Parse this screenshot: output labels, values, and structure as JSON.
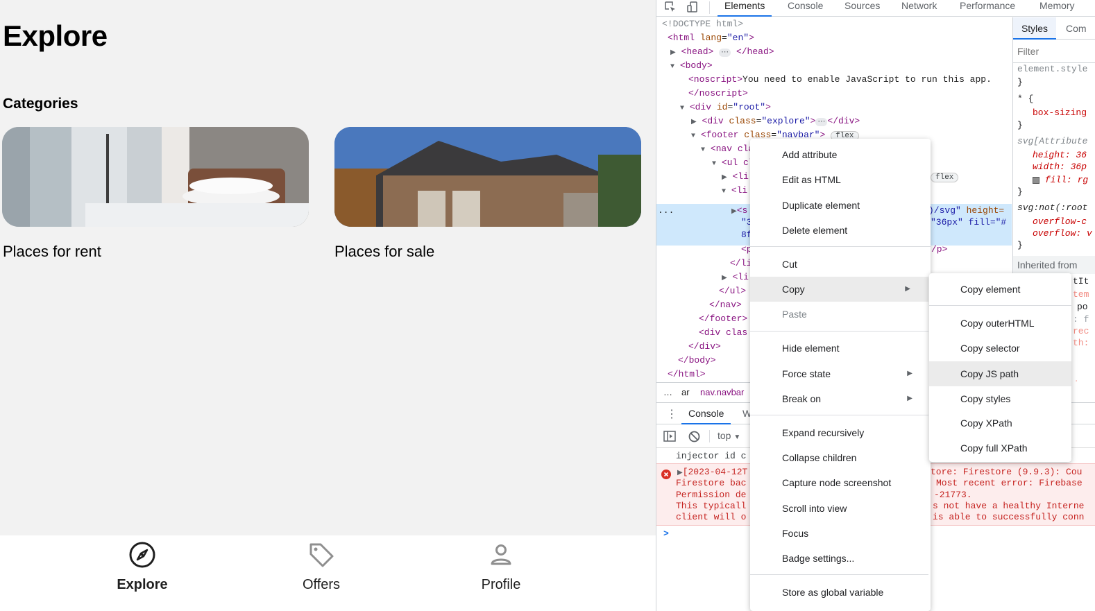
{
  "app": {
    "title": "Explore",
    "section_title": "Categories",
    "cards": [
      {
        "label": "Places for rent"
      },
      {
        "label": "Places for sale"
      }
    ],
    "navbar": [
      {
        "label": "Explore",
        "icon": "compass-icon",
        "active": true
      },
      {
        "label": "Offers",
        "icon": "tag-icon",
        "active": false
      },
      {
        "label": "Profile",
        "icon": "person-icon",
        "active": false
      }
    ]
  },
  "devtools": {
    "tabs": [
      "Elements",
      "Console",
      "Sources",
      "Network",
      "Performance",
      "Memory"
    ],
    "active_tab": "Elements",
    "dom": {
      "doctype": "<!DOCTYPE html>",
      "html_open": "<html",
      "html_attr": "lang",
      "html_val": "\"en\"",
      "gt": ">",
      "head": "<head>",
      "head_close": "</head>",
      "body_open": "<body>",
      "noscript_open": "<noscript>",
      "noscript_text": "You need to enable JavaScript to run this app.",
      "noscript_close": "</noscript>",
      "div": "<div",
      "id_attr": "id",
      "root_val": "\"root\"",
      "class_attr": "class",
      "explore_val": "\"explore\"",
      "div_close": "</div>",
      "footer_open": "<footer",
      "navbar_val": "\"navbar\"",
      "flex_badge": "flex",
      "nav_partial": "<nav cla",
      "ul_partial": "<ul cl",
      "li_partial": "<li",
      "svg_partial": "<s",
      "sel_right_1a": ")/svg\"",
      "sel_right_1b": "height=",
      "sel_right_2": "\"36px\" fill=\"#",
      "sel_left_2": "\"3",
      "sel_left_3": "8f",
      "p_partial": "<p",
      "p_close_right": "/p>",
      "li_close": "</li",
      "ul_close": "</ul>",
      "nav_close": "</nav>",
      "footer_close": "</footer>",
      "div_clas": "<div clas",
      "body_close": "</body>",
      "html_close": "</html>",
      "ellipsis": "..."
    },
    "breadcrumb": {
      "left": "ar",
      "item": "nav.navbar"
    },
    "drawer_tabs": [
      "Console",
      "W"
    ],
    "console_context": "top",
    "console_lines": {
      "injector": "injector id c",
      "err_date": "[2023-04-12T",
      "err_line2": "Firestore bac",
      "err_line3": "Permission de",
      "err_line4": "This typicall",
      "err_line5": "client will o",
      "err_right1": "tore: Firestore (9.9.3): Cou",
      "err_right2": "Most recent error: Firebase",
      "err_right3": "-21773.",
      "err_right4": "s not have a healthy Interne",
      "err_right5": "is able to successfully conn",
      "prompt": ">"
    },
    "styles_pane": {
      "tabs": [
        "Styles",
        "Com"
      ],
      "filter_placeholder": "Filter",
      "lines": [
        "element.style",
        "}",
        "* {",
        "box-sizing",
        "}",
        "svg[Attribute",
        "height: 36",
        "width: 36p",
        "fill: rg",
        "}",
        "svg:not(:root",
        "overflow-c",
        "overflow: v",
        "}"
      ],
      "inherited": "Inherited from",
      "frag1": "tIt",
      "frag2": "tem",
      "frag3": "po",
      "frag4": ": f",
      "frag5": "rec",
      "frag6": "th:",
      "frag7": "ign"
    }
  },
  "context_menu": {
    "items": [
      {
        "label": "Add attribute"
      },
      {
        "label": "Edit as HTML"
      },
      {
        "label": "Duplicate element"
      },
      {
        "label": "Delete element"
      },
      {
        "label": "Cut"
      },
      {
        "label": "Copy",
        "has_submenu": true,
        "highlighted": true
      },
      {
        "label": "Paste",
        "disabled": true
      },
      {
        "label": "Hide element"
      },
      {
        "label": "Force state",
        "has_submenu": true
      },
      {
        "label": "Break on",
        "has_submenu": true
      },
      {
        "label": "Expand recursively"
      },
      {
        "label": "Collapse children"
      },
      {
        "label": "Capture node screenshot"
      },
      {
        "label": "Scroll into view"
      },
      {
        "label": "Focus"
      },
      {
        "label": "Badge settings..."
      },
      {
        "label": "Store as global variable"
      }
    ]
  },
  "copy_submenu": {
    "items": [
      {
        "label": "Copy element"
      },
      {
        "label": "Copy outerHTML"
      },
      {
        "label": "Copy selector"
      },
      {
        "label": "Copy JS path",
        "highlighted": true
      },
      {
        "label": "Copy styles"
      },
      {
        "label": "Copy XPath"
      },
      {
        "label": "Copy full XPath"
      }
    ]
  },
  "colors": {
    "accent": "#1a73e8",
    "selection": "#cfe8fc",
    "tag": "#881280",
    "attr": "#994500",
    "attr_value": "#1a1aa6",
    "error": "#c5221f"
  }
}
